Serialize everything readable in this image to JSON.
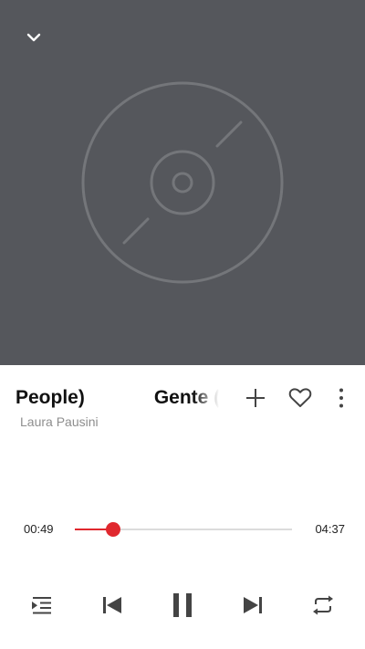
{
  "player": {
    "title": "Gente (Good People)",
    "title_visible_parts": [
      "Peopl e)",
      "Gente ("
    ],
    "artist": "Laura Pausini",
    "current_time": "00:49",
    "total_time": "04:37",
    "progress_fraction": 0.177
  },
  "colors": {
    "artwork_bg": "#55575c",
    "accent": "#e0282e",
    "icon": "#444444"
  },
  "icons": {
    "collapse": "chevron-down-icon",
    "placeholder": "disc-icon",
    "add": "plus-icon",
    "favorite": "heart-icon",
    "more": "more-vertical-icon",
    "queue": "queue-list-icon",
    "previous": "skip-previous-icon",
    "play_pause": "pause-icon",
    "next": "skip-next-icon",
    "repeat": "repeat-icon"
  }
}
